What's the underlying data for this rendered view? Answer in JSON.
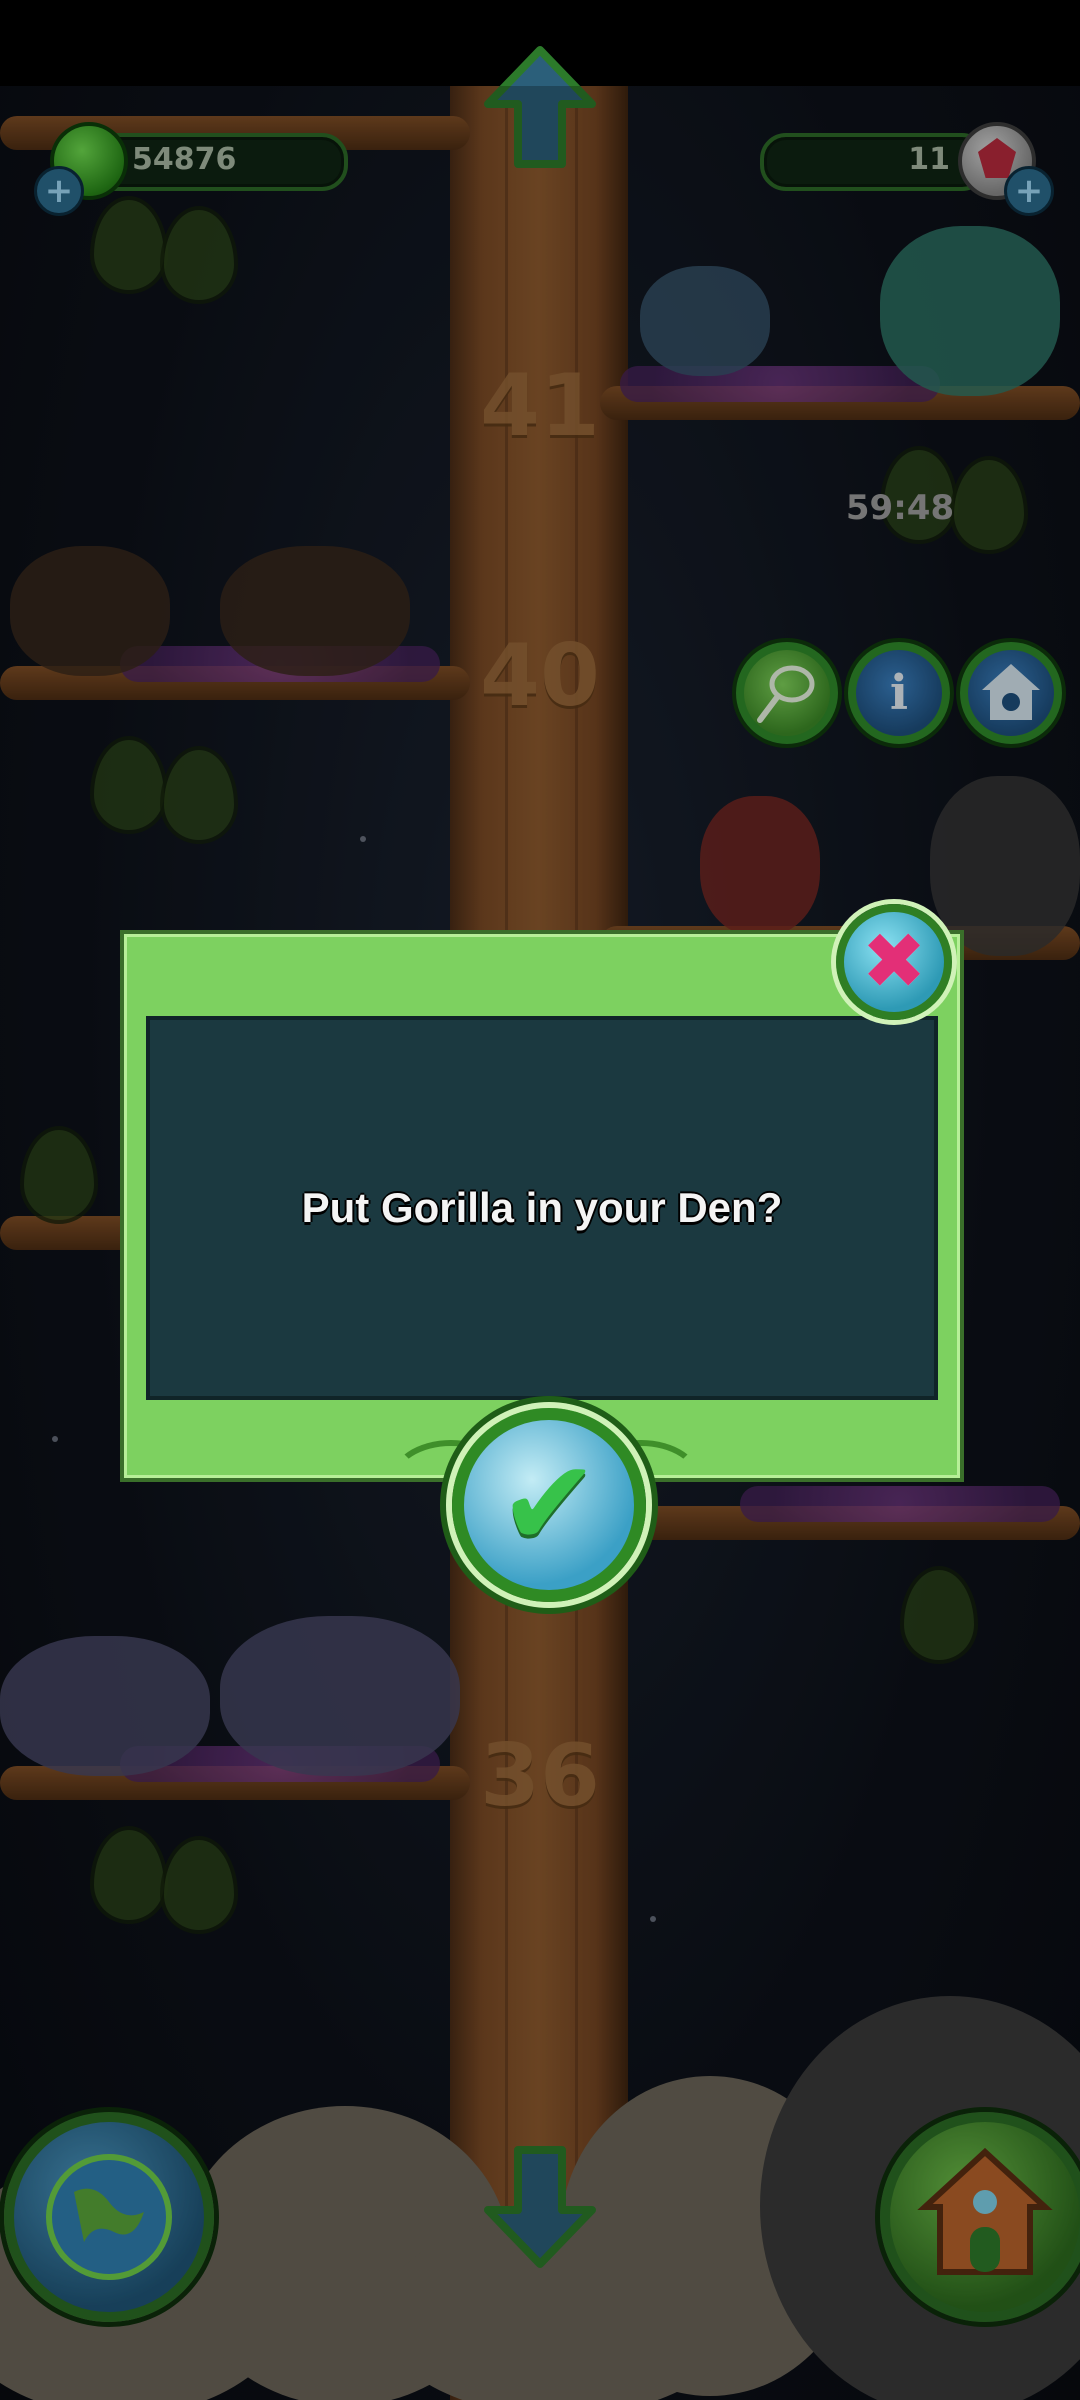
{
  "hud": {
    "coins": "54876",
    "gems": "11",
    "timer": "59:48"
  },
  "tree": {
    "levels": [
      "41",
      "40",
      "36"
    ]
  },
  "icons": {
    "coin": "green-gem-icon",
    "gem": "ruby-icon",
    "add": "plus-icon",
    "up": "arrow-up-icon",
    "down": "arrow-down-icon",
    "net": "net-icon",
    "info": "info-icon",
    "den": "den-icon",
    "globe": "globe-icon",
    "house": "house-icon",
    "close": "close-x-icon",
    "confirm": "checkmark-icon"
  },
  "dialog": {
    "message": "Put Gorilla in your Den?"
  },
  "buttons": {
    "info_glyph": "i",
    "close_glyph": "✖",
    "confirm_glyph": "✔",
    "plus_glyph": "+"
  },
  "colors": {
    "dialog_frame": "#7dd160",
    "dialog_body": "#1b3940",
    "confirm_check": "#37c24a",
    "close_x": "#e32f77"
  }
}
